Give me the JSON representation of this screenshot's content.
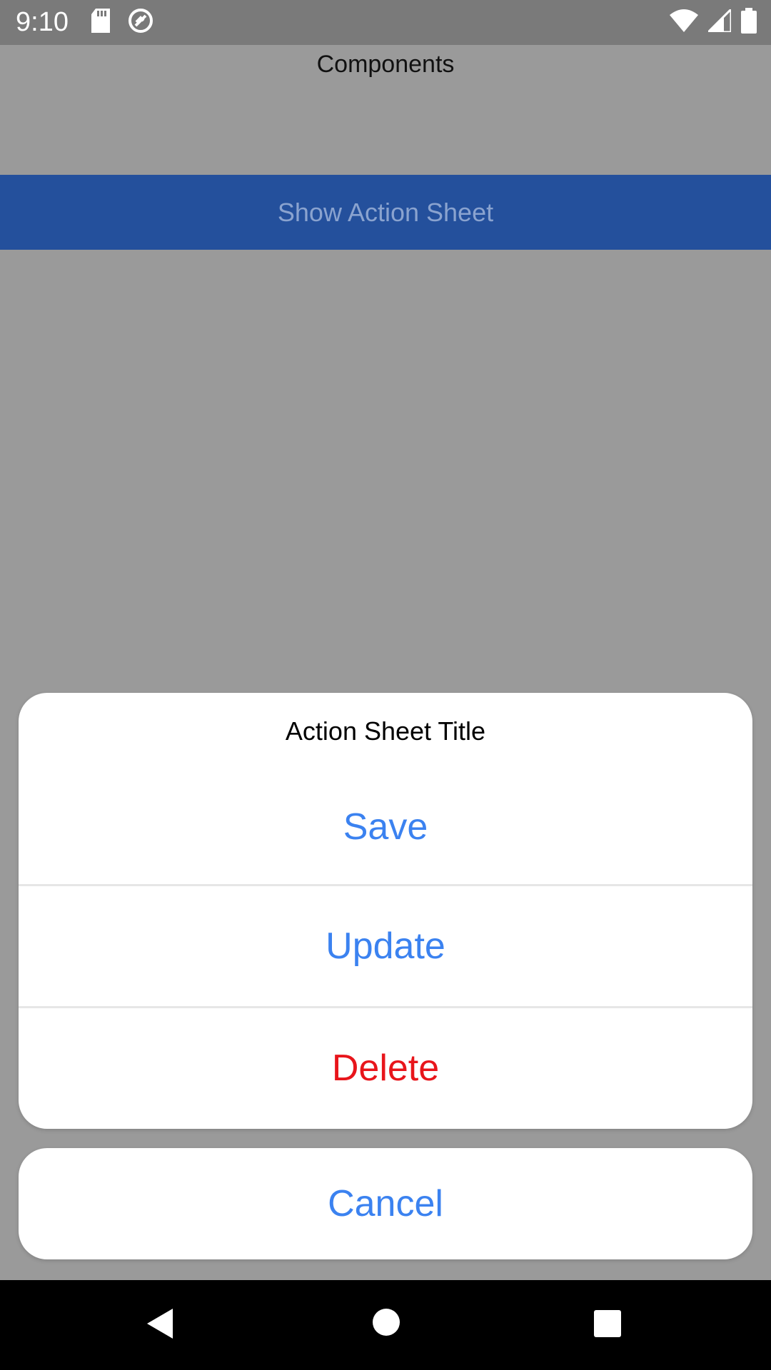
{
  "status_bar": {
    "time": "9:10",
    "icons": [
      "sd-card-icon",
      "no-disturb-icon",
      "wifi-icon",
      "signal-icon",
      "battery-icon"
    ]
  },
  "app": {
    "title": "Components",
    "show_button_label": "Show Action Sheet"
  },
  "action_sheet": {
    "title": "Action Sheet Title",
    "options": [
      {
        "label": "Save",
        "color": "#3b82f0"
      },
      {
        "label": "Update",
        "color": "#3b82f0"
      },
      {
        "label": "Delete",
        "color": "#e8151b"
      }
    ],
    "cancel_label": "Cancel",
    "cancel_color": "#3b82f0"
  },
  "nav_bar": {
    "buttons": [
      "back-icon",
      "home-icon",
      "recents-icon"
    ]
  }
}
